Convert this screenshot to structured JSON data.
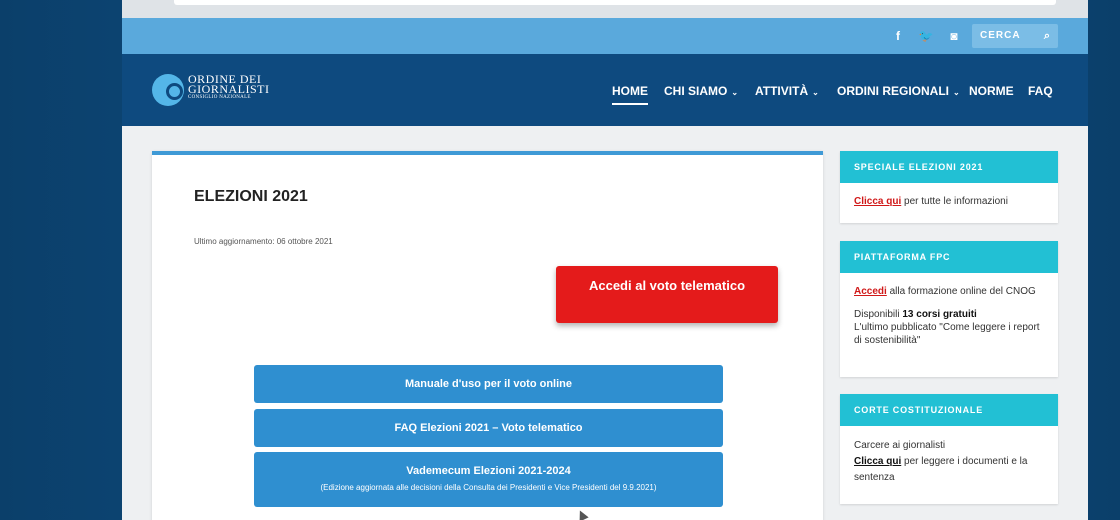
{
  "topbar": {
    "social": [
      {
        "icon": "facebook-icon",
        "glyph": "f"
      },
      {
        "icon": "twitter-icon",
        "glyph": "🐦"
      },
      {
        "icon": "instagram-icon",
        "glyph": "◙"
      }
    ],
    "search_label": "CERCA",
    "search_glyph": "⌕"
  },
  "logo": {
    "line1": "ORDINE DEI",
    "line2": "GIORNALISTI",
    "line3": "CONSIGLIO NAZIONALE"
  },
  "nav": {
    "home": "HOME",
    "chi_siamo": "CHI SIAMO",
    "attivita": "ATTIVITÀ",
    "ordini_regionali": "ORDINI REGIONALI",
    "norme": "NORME",
    "faq": "FAQ",
    "chevron": "⌄"
  },
  "main": {
    "title": "ELEZIONI 2021",
    "updated": "Ultimo aggiornamento: 06 ottobre 2021",
    "vote_button": "Accedi al voto telematico",
    "buttons": {
      "manual": "Manuale d'uso per il voto online",
      "faq": "FAQ Elezioni 2021 – Voto telematico",
      "vademecum": "Vademecum Elezioni 2021-2024",
      "vademecum_sub": "(Edizione aggiornata alle decisioni della Consulta dei Presidenti e Vice Presidenti del 9.9.2021)"
    }
  },
  "sidebar": {
    "elezioni": {
      "title": "SPECIALE ELEZIONI 2021",
      "link": "Clicca qui",
      "text": " per tutte le informazioni"
    },
    "fpc": {
      "title": "PIATTAFORMA FPC",
      "link": "Accedi",
      "text": " alla formazione online del CNOG",
      "available_prefix": "Disponibili ",
      "available_bold": "13 corsi gratuiti",
      "latest": "L'ultimo pubblicato \"Come leggere i report di sostenibilità\""
    },
    "corte": {
      "title": "CORTE COSTITUZIONALE",
      "line1": "Carcere ai giornalisti",
      "link": "Clicca qui",
      "text": " per leggere i documenti e la sentenza"
    }
  }
}
